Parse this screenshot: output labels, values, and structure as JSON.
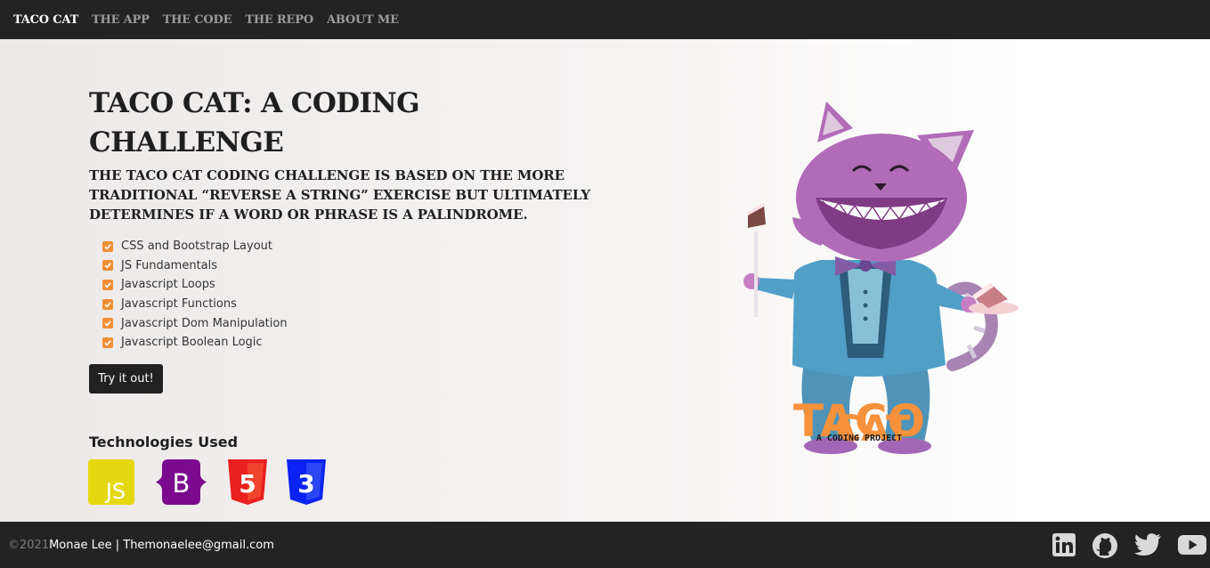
{
  "nav": {
    "brand": "TACO CAT",
    "links": [
      "THE APP",
      "THE CODE",
      "THE REPO",
      "ABOUT ME"
    ]
  },
  "hero": {
    "title": "TACO CAT: A CODING CHALLENGE",
    "lead": "THE TACO CAT CODING CHALLENGE IS BASED ON THE MORE TRADITIONAL “REVERSE A STRING” EXERCISE BUT ULTIMATELY DETERMINES IF A WORD OR PHRASE IS A PALINDROME.",
    "features": [
      "CSS and Bootstrap Layout",
      "JS Fundamentals",
      "Javascript Loops",
      "Javascript Functions",
      "Javascript Dom Manipulation",
      "Javascript Boolean Logic"
    ],
    "cta_label": "Try it out!",
    "tech_heading": "Technologies Used",
    "tech_icons": [
      {
        "name": "javascript-icon",
        "label": "JS",
        "color": "#e5d810"
      },
      {
        "name": "bootstrap-icon",
        "label": "B",
        "color": "#7b0a8e"
      },
      {
        "name": "html5-icon",
        "label": "5",
        "color": "#ea1f1f"
      },
      {
        "name": "css3-icon",
        "label": "3",
        "color": "#0b23f2"
      }
    ]
  },
  "mascot": {
    "logo_line1": "TACO",
    "logo_line2": "CAT",
    "tagline": "A CODING PROJECT"
  },
  "footer": {
    "copyright": "©2021",
    "credit": "Monae Lee | Themonaelee@gmail.com",
    "social": [
      "linkedin-icon",
      "github-icon",
      "twitter-icon",
      "youtube-icon"
    ]
  },
  "colors": {
    "navbar_bg": "#232323",
    "accent_check": "#f28f35",
    "cta_bg": "#212121",
    "logo_orange": "#f7913b"
  }
}
